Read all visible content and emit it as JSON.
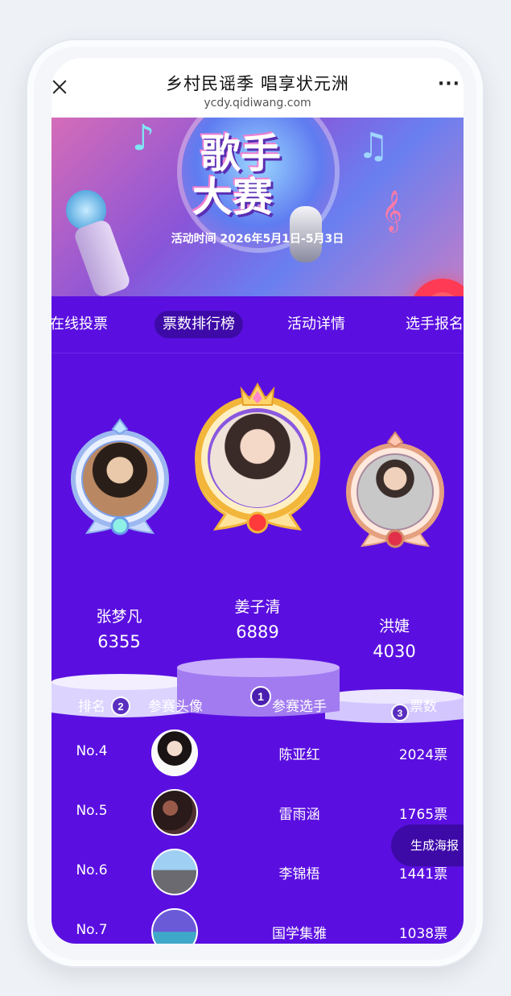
{
  "header": {
    "title": "乡村民谣季 唱享状元洲",
    "url": "ycdy.qidiwang.com",
    "close_icon": "close-icon",
    "more_icon": "more-icon"
  },
  "banner": {
    "title_line1": "歌手",
    "title_line2": "大赛",
    "date_text": "活动时间 2026年5月1日-5月3日"
  },
  "tabs": [
    {
      "label": "在线投票"
    },
    {
      "label": "票数排行榜"
    },
    {
      "label": "活动详情"
    },
    {
      "label": "选手报名"
    }
  ],
  "podium": [
    {
      "rank": "1",
      "name": "姜子清",
      "votes": "6889"
    },
    {
      "rank": "2",
      "name": "张梦凡",
      "votes": "6355"
    },
    {
      "rank": "3",
      "name": "洪婕",
      "votes": "4030"
    }
  ],
  "table": {
    "headers": [
      "排名",
      "参赛头像",
      "参赛选手",
      "票数"
    ],
    "rows": [
      {
        "rank": "No.4",
        "name": "陈亚红",
        "votes": "2024票"
      },
      {
        "rank": "No.5",
        "name": "雷雨涵",
        "votes": "1765票"
      },
      {
        "rank": "No.6",
        "name": "李锦梧",
        "votes": "1441票"
      },
      {
        "rank": "No.7",
        "name": "国学集雅",
        "votes": "1038票"
      }
    ]
  },
  "poster_button": "生成海报",
  "colors": {
    "main_bg": "#5a0fe0",
    "active_tab_bg": "#3d0aa8",
    "gold": "#f2b63a",
    "silver": "#a9c6f5",
    "bronze": "#e4a07f"
  }
}
